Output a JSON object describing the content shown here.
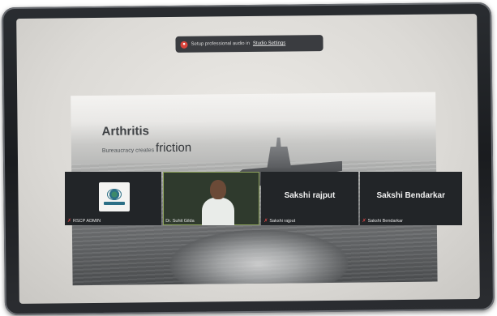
{
  "notification": {
    "text": "Setup professional audio in",
    "link": "Studio Settings"
  },
  "slide": {
    "title": "Arthritis",
    "subtitle_prefix": "Bureaucracy creates",
    "subtitle_accent": "friction"
  },
  "participants": [
    {
      "name": "RSCP ADMIN",
      "display": "",
      "muted": true,
      "type": "logo"
    },
    {
      "name": "Dr. Suhit Gilda",
      "display": "",
      "muted": false,
      "type": "video"
    },
    {
      "name": "Sakshi rajput",
      "display": "Sakshi rajput",
      "muted": true,
      "type": "name"
    },
    {
      "name": "Sakshi Bendarkar",
      "display": "Sakshi Bendarkar",
      "muted": true,
      "type": "name"
    }
  ],
  "colors": {
    "mic_off": "#e04545",
    "active_speaker_border": "#8ea35c",
    "tile_bg": "#222528"
  },
  "icons": {
    "notification": "record-icon",
    "mic_off": "mic-off-icon"
  }
}
